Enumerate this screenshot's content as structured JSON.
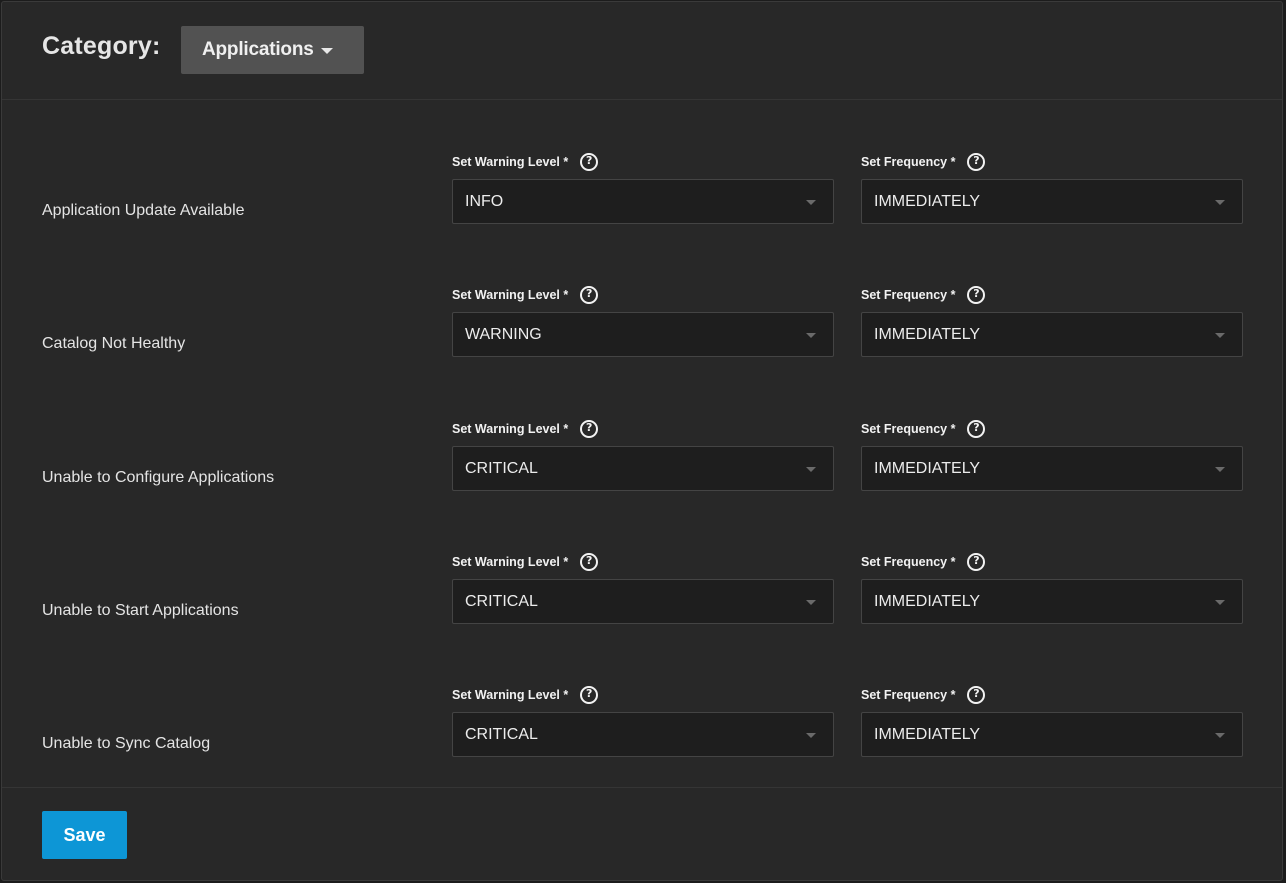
{
  "header": {
    "category_label": "Category:",
    "category_value": "Applications",
    "category_icon": "caret-down-icon"
  },
  "labels": {
    "warning_level": "Set Warning Level *",
    "frequency": "Set Frequency *",
    "help_icon": "help-circle-icon",
    "dropdown_icon": "dropdown-arrow-icon"
  },
  "alerts": [
    {
      "name": "Application Update Available",
      "level": "INFO",
      "frequency": "IMMEDIATELY"
    },
    {
      "name": "Catalog Not Healthy",
      "level": "WARNING",
      "frequency": "IMMEDIATELY"
    },
    {
      "name": "Unable to Configure Applications",
      "level": "CRITICAL",
      "frequency": "IMMEDIATELY"
    },
    {
      "name": "Unable to Start Applications",
      "level": "CRITICAL",
      "frequency": "IMMEDIATELY"
    },
    {
      "name": "Unable to Sync Catalog",
      "level": "CRITICAL",
      "frequency": "IMMEDIATELY"
    }
  ],
  "footer": {
    "save_label": "Save"
  },
  "colors": {
    "background": "#282828",
    "select_background": "#1e1e1e",
    "category_button": "#525252",
    "primary": "#0d96d6"
  }
}
